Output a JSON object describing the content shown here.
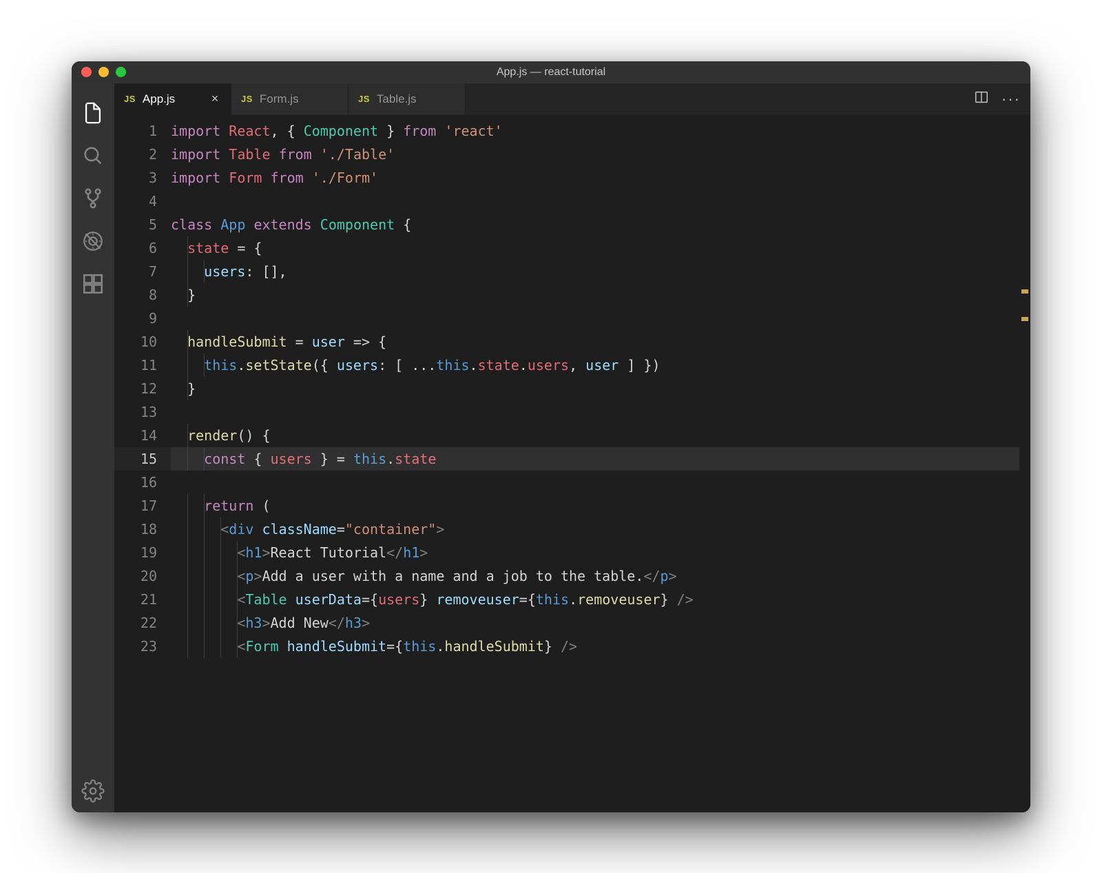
{
  "window": {
    "title": "App.js — react-tutorial"
  },
  "activitybar": {
    "items": [
      {
        "name": "explorer",
        "active": true
      },
      {
        "name": "search",
        "active": false
      },
      {
        "name": "source-control",
        "active": false
      },
      {
        "name": "debug",
        "active": false
      },
      {
        "name": "extensions",
        "active": false
      }
    ],
    "bottom": [
      {
        "name": "settings"
      }
    ]
  },
  "tabs": [
    {
      "icon": "JS",
      "label": "App.js",
      "active": true,
      "closable": true
    },
    {
      "icon": "JS",
      "label": "Form.js",
      "active": false,
      "closable": false
    },
    {
      "icon": "JS",
      "label": "Table.js",
      "active": false,
      "closable": false
    }
  ],
  "editor": {
    "current_line": 15,
    "lines": [
      {
        "n": 1,
        "indent": 0,
        "tokens": [
          [
            "kw",
            "import"
          ],
          [
            "txt",
            " "
          ],
          [
            "prop",
            "React"
          ],
          [
            "pun",
            ", { "
          ],
          [
            "type",
            "Component"
          ],
          [
            "pun",
            " } "
          ],
          [
            "kw",
            "from"
          ],
          [
            "txt",
            " "
          ],
          [
            "str",
            "'react'"
          ]
        ]
      },
      {
        "n": 2,
        "indent": 0,
        "tokens": [
          [
            "kw",
            "import"
          ],
          [
            "txt",
            " "
          ],
          [
            "prop",
            "Table"
          ],
          [
            "txt",
            " "
          ],
          [
            "kw",
            "from"
          ],
          [
            "txt",
            " "
          ],
          [
            "str",
            "'./Table'"
          ]
        ]
      },
      {
        "n": 3,
        "indent": 0,
        "tokens": [
          [
            "kw",
            "import"
          ],
          [
            "txt",
            " "
          ],
          [
            "prop",
            "Form"
          ],
          [
            "txt",
            " "
          ],
          [
            "kw",
            "from"
          ],
          [
            "txt",
            " "
          ],
          [
            "str",
            "'./Form'"
          ]
        ]
      },
      {
        "n": 4,
        "indent": 0,
        "tokens": []
      },
      {
        "n": 5,
        "indent": 0,
        "tokens": [
          [
            "kw",
            "class"
          ],
          [
            "txt",
            " "
          ],
          [
            "cls",
            "App"
          ],
          [
            "txt",
            " "
          ],
          [
            "kw",
            "extends"
          ],
          [
            "txt",
            " "
          ],
          [
            "type",
            "Component"
          ],
          [
            "pun",
            " {"
          ]
        ]
      },
      {
        "n": 6,
        "indent": 1,
        "tokens": [
          [
            "prop",
            "state"
          ],
          [
            "pun",
            " = {"
          ]
        ]
      },
      {
        "n": 7,
        "indent": 2,
        "tokens": [
          [
            "attr",
            "users"
          ],
          [
            "pun",
            ": [],"
          ]
        ]
      },
      {
        "n": 8,
        "indent": 1,
        "tokens": [
          [
            "pun",
            "}"
          ]
        ]
      },
      {
        "n": 9,
        "indent": 0,
        "tokens": []
      },
      {
        "n": 10,
        "indent": 1,
        "tokens": [
          [
            "fn",
            "handleSubmit"
          ],
          [
            "pun",
            " = "
          ],
          [
            "attr",
            "user"
          ],
          [
            "pun",
            " => {"
          ]
        ]
      },
      {
        "n": 11,
        "indent": 2,
        "tokens": [
          [
            "cls",
            "this"
          ],
          [
            "pun",
            "."
          ],
          [
            "fn",
            "setState"
          ],
          [
            "pun",
            "({ "
          ],
          [
            "attr",
            "users"
          ],
          [
            "pun",
            ": [ ..."
          ],
          [
            "cls",
            "this"
          ],
          [
            "pun",
            "."
          ],
          [
            "prop",
            "state"
          ],
          [
            "pun",
            "."
          ],
          [
            "prop",
            "users"
          ],
          [
            "pun",
            ", "
          ],
          [
            "attr",
            "user"
          ],
          [
            "pun",
            " ] })"
          ]
        ]
      },
      {
        "n": 12,
        "indent": 1,
        "tokens": [
          [
            "pun",
            "}"
          ]
        ]
      },
      {
        "n": 13,
        "indent": 0,
        "tokens": []
      },
      {
        "n": 14,
        "indent": 1,
        "tokens": [
          [
            "fn",
            "render"
          ],
          [
            "pun",
            "() {"
          ]
        ]
      },
      {
        "n": 15,
        "indent": 2,
        "tokens": [
          [
            "kw",
            "const"
          ],
          [
            "pun",
            " { "
          ],
          [
            "prop",
            "users"
          ],
          [
            "pun",
            " } = "
          ],
          [
            "cls",
            "this"
          ],
          [
            "pun",
            "."
          ],
          [
            "prop",
            "state"
          ]
        ]
      },
      {
        "n": 16,
        "indent": 0,
        "tokens": []
      },
      {
        "n": 17,
        "indent": 2,
        "tokens": [
          [
            "kw",
            "return"
          ],
          [
            "pun",
            " ("
          ]
        ]
      },
      {
        "n": 18,
        "indent": 3,
        "tokens": [
          [
            "tag",
            "<"
          ],
          [
            "tagn",
            "div"
          ],
          [
            "txt",
            " "
          ],
          [
            "attr",
            "className"
          ],
          [
            "pun",
            "="
          ],
          [
            "str",
            "\"container\""
          ],
          [
            "tag",
            ">"
          ]
        ]
      },
      {
        "n": 19,
        "indent": 4,
        "tokens": [
          [
            "tag",
            "<"
          ],
          [
            "tagn",
            "h1"
          ],
          [
            "tag",
            ">"
          ],
          [
            "txt",
            "React Tutorial"
          ],
          [
            "tag",
            "</"
          ],
          [
            "tagn",
            "h1"
          ],
          [
            "tag",
            ">"
          ]
        ]
      },
      {
        "n": 20,
        "indent": 4,
        "tokens": [
          [
            "tag",
            "<"
          ],
          [
            "tagn",
            "p"
          ],
          [
            "tag",
            ">"
          ],
          [
            "txt",
            "Add a user with a name and a job to the table."
          ],
          [
            "tag",
            "</"
          ],
          [
            "tagn",
            "p"
          ],
          [
            "tag",
            ">"
          ]
        ]
      },
      {
        "n": 21,
        "indent": 4,
        "tokens": [
          [
            "tag",
            "<"
          ],
          [
            "comp",
            "Table"
          ],
          [
            "txt",
            " "
          ],
          [
            "attr",
            "userData"
          ],
          [
            "pun",
            "={"
          ],
          [
            "prop",
            "users"
          ],
          [
            "pun",
            "} "
          ],
          [
            "attr",
            "removeuser"
          ],
          [
            "pun",
            "={"
          ],
          [
            "cls",
            "this"
          ],
          [
            "pun",
            "."
          ],
          [
            "fn",
            "removeuser"
          ],
          [
            "pun",
            "} "
          ],
          [
            "tag",
            "/>"
          ]
        ]
      },
      {
        "n": 22,
        "indent": 4,
        "tokens": [
          [
            "tag",
            "<"
          ],
          [
            "tagn",
            "h3"
          ],
          [
            "tag",
            ">"
          ],
          [
            "txt",
            "Add New"
          ],
          [
            "tag",
            "</"
          ],
          [
            "tagn",
            "h3"
          ],
          [
            "tag",
            ">"
          ]
        ]
      },
      {
        "n": 23,
        "indent": 4,
        "tokens": [
          [
            "tag",
            "<"
          ],
          [
            "comp",
            "Form"
          ],
          [
            "txt",
            " "
          ],
          [
            "attr",
            "handleSubmit"
          ],
          [
            "pun",
            "={"
          ],
          [
            "cls",
            "this"
          ],
          [
            "pun",
            "."
          ],
          [
            "fn",
            "handleSubmit"
          ],
          [
            "pun",
            "} "
          ],
          [
            "tag",
            "/>"
          ]
        ]
      }
    ]
  },
  "ruler_marks": [
    25,
    29
  ]
}
